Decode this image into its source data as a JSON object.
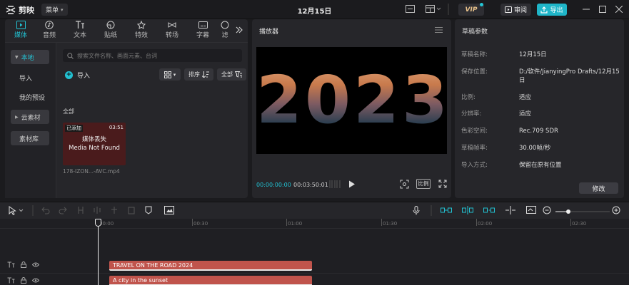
{
  "app": {
    "logo_text": "剪映",
    "menu_label": "菜单",
    "title": "12月15日",
    "vip_label": "VIP",
    "review_label": "审阅",
    "export_label": "导出"
  },
  "media_panel": {
    "tabs": [
      {
        "label": "媒体",
        "icon": "media-icon"
      },
      {
        "label": "音频",
        "icon": "audio-icon"
      },
      {
        "label": "文本",
        "icon": "text-icon"
      },
      {
        "label": "贴纸",
        "icon": "sticker-icon"
      },
      {
        "label": "特效",
        "icon": "effects-icon"
      },
      {
        "label": "转场",
        "icon": "transition-icon"
      },
      {
        "label": "字幕",
        "icon": "subtitle-icon"
      },
      {
        "label": "滤",
        "icon": "filter-icon"
      }
    ],
    "side_items": [
      "本地",
      "导入",
      "我的预设",
      "云素材",
      "素材库"
    ],
    "search_placeholder": "搜索文件名称、画面元素、台词",
    "import_label": "导入",
    "sort_label": "排序",
    "filter_label": "全部",
    "section_label": "全部",
    "clip": {
      "badge": "已添加",
      "duration": "03:51",
      "message_cn": "媒体丢失",
      "message_en": "Media Not Found",
      "filename": "178-IZON...-AVC.mp4"
    }
  },
  "player": {
    "title": "播放器",
    "canvas_text": "2023",
    "current_time": "00:00:00:00",
    "total_time": "00:03:50:01",
    "ratio_label": "比例"
  },
  "draft": {
    "title": "草稿参数",
    "rows": [
      {
        "label": "草稿名称:",
        "value": "12月15日"
      },
      {
        "label": "保存位置:",
        "value": "D:/软件/JianyingPro Drafts/12月15日"
      },
      {
        "label": "比例:",
        "value": "适应"
      },
      {
        "label": "分辨率:",
        "value": "适应"
      },
      {
        "label": "色彩空间:",
        "value": "Rec.709 SDR"
      },
      {
        "label": "草稿帧率:",
        "value": "30.00帧/秒"
      },
      {
        "label": "导入方式:",
        "value": "保留在原有位置"
      }
    ],
    "modify_label": "修改"
  },
  "timeline": {
    "ticks": [
      "00:00",
      "00:30",
      "01:00",
      "01:30",
      "02:00",
      "02:30"
    ],
    "clips": [
      "TRAVEL ON THE ROAD 2024",
      "A city in the sunset"
    ]
  }
}
